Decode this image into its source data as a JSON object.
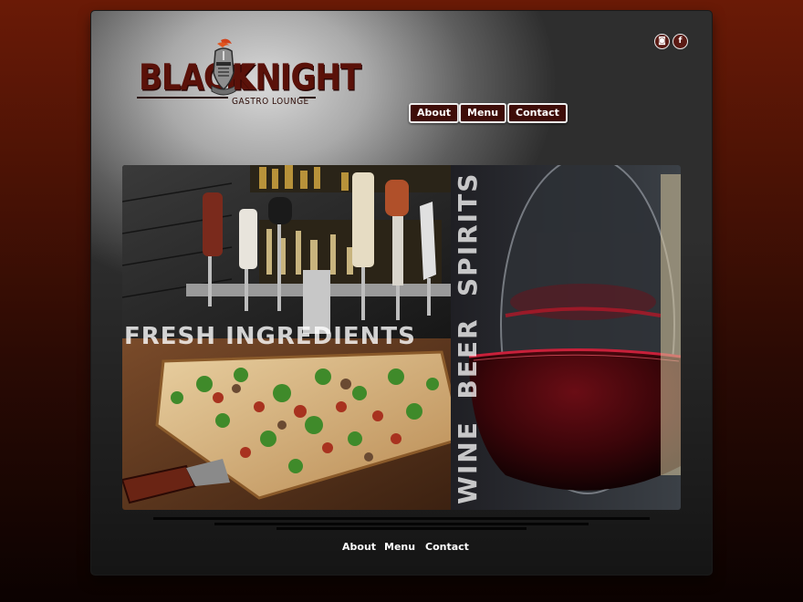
{
  "logo": {
    "word_left": "BLACK",
    "word_right": "KNIGHT",
    "subtitle": "GASTRO LOUNGE"
  },
  "social": [
    {
      "icon": "instagram-icon",
      "glyph": "◙"
    },
    {
      "icon": "facebook-icon",
      "glyph": "f"
    }
  ],
  "nav": {
    "about": "About",
    "menu": "Menu",
    "contact": "Contact"
  },
  "hero": {
    "caption_horizontal": "FRESH INGREDIENTS",
    "caption_vertical": "WINE  BEER  SPIRITS"
  },
  "footer_nav": {
    "about": "About",
    "menu": "Menu",
    "contact": "Contact"
  },
  "colors": {
    "brand_red": "#5a1109",
    "button_bg": "#3e0d08",
    "page_bg_top": "#6a1a06"
  }
}
